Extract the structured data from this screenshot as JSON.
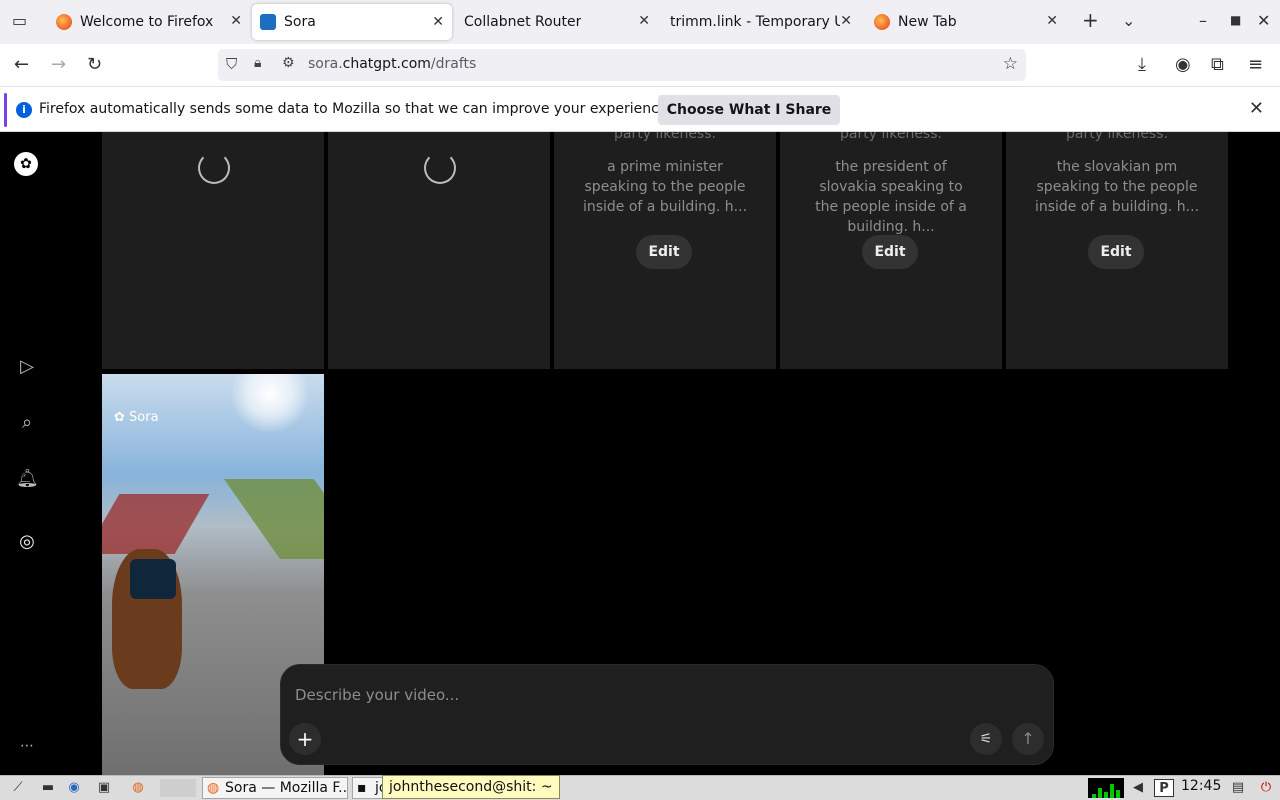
{
  "browser": {
    "tabs": [
      {
        "title": "Welcome to Firefox",
        "active": false
      },
      {
        "title": "Sora",
        "active": true
      },
      {
        "title": "Collabnet Router",
        "active": false
      },
      {
        "title": "trimm.link - Temporary U",
        "active": false
      },
      {
        "title": "New Tab",
        "active": false
      }
    ],
    "new_tab": "+",
    "tab_list": "⌄",
    "url_domain": "sora.",
    "url_host": "chatgpt.com",
    "url_path": "/drafts"
  },
  "notification": {
    "text": "Firefox automatically sends some data to Mozilla so that we can improve your experience.",
    "button": "Choose What I Share"
  },
  "cards": [
    {
      "type": "loading"
    },
    {
      "type": "loading"
    },
    {
      "type": "draft",
      "clipped": "party likeness.",
      "prompt": "a prime minister speaking to the people inside of a building. h...",
      "edit": "Edit"
    },
    {
      "type": "draft",
      "clipped": "party likeness.",
      "prompt": "the president of slovakia speaking to the people inside of a building. h...",
      "edit": "Edit"
    },
    {
      "type": "draft",
      "clipped": "party likeness.",
      "prompt": "the slovakian pm speaking to the people inside of a building. h...",
      "edit": "Edit"
    }
  ],
  "video": {
    "watermark": "Sora"
  },
  "composer": {
    "placeholder": "Describe your video..."
  },
  "taskbar": {
    "task_firefox": "Sora — Mozilla F...",
    "task_terminal": "jo",
    "tooltip": "johnthesecond@shit: ~",
    "clock": "12:45"
  }
}
